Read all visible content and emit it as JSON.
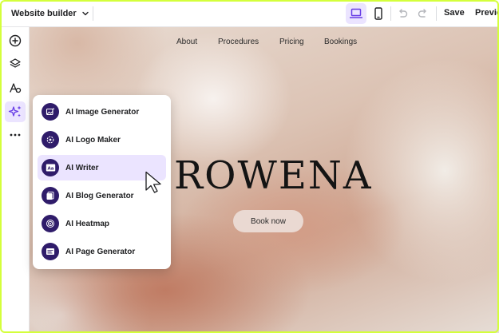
{
  "topbar": {
    "app_title": "Website builder",
    "save_label": "Save",
    "preview_label": "Preview"
  },
  "sidebar": {
    "items": [
      {
        "name": "add-icon"
      },
      {
        "name": "layers-icon"
      },
      {
        "name": "styles-icon"
      },
      {
        "name": "ai-tools-icon",
        "active": true
      },
      {
        "name": "more-icon"
      }
    ]
  },
  "site": {
    "nav": [
      "About",
      "Procedures",
      "Pricing",
      "Bookings"
    ],
    "title": "ROWENA",
    "cta": "Book now"
  },
  "ai_menu": {
    "items": [
      {
        "label": "AI Image Generator",
        "icon": "image-generator-icon"
      },
      {
        "label": "AI Logo Maker",
        "icon": "logo-maker-icon"
      },
      {
        "label": "AI Writer",
        "icon": "writer-icon",
        "active": true
      },
      {
        "label": "AI Blog Generator",
        "icon": "blog-generator-icon"
      },
      {
        "label": "AI Heatmap",
        "icon": "heatmap-icon"
      },
      {
        "label": "AI Page Generator",
        "icon": "page-generator-icon"
      }
    ]
  },
  "colors": {
    "accent": "#673de6",
    "accent_bg": "#ebe4ff",
    "icon_bg": "#2f1c6a",
    "frame": "#d4ff3b"
  }
}
